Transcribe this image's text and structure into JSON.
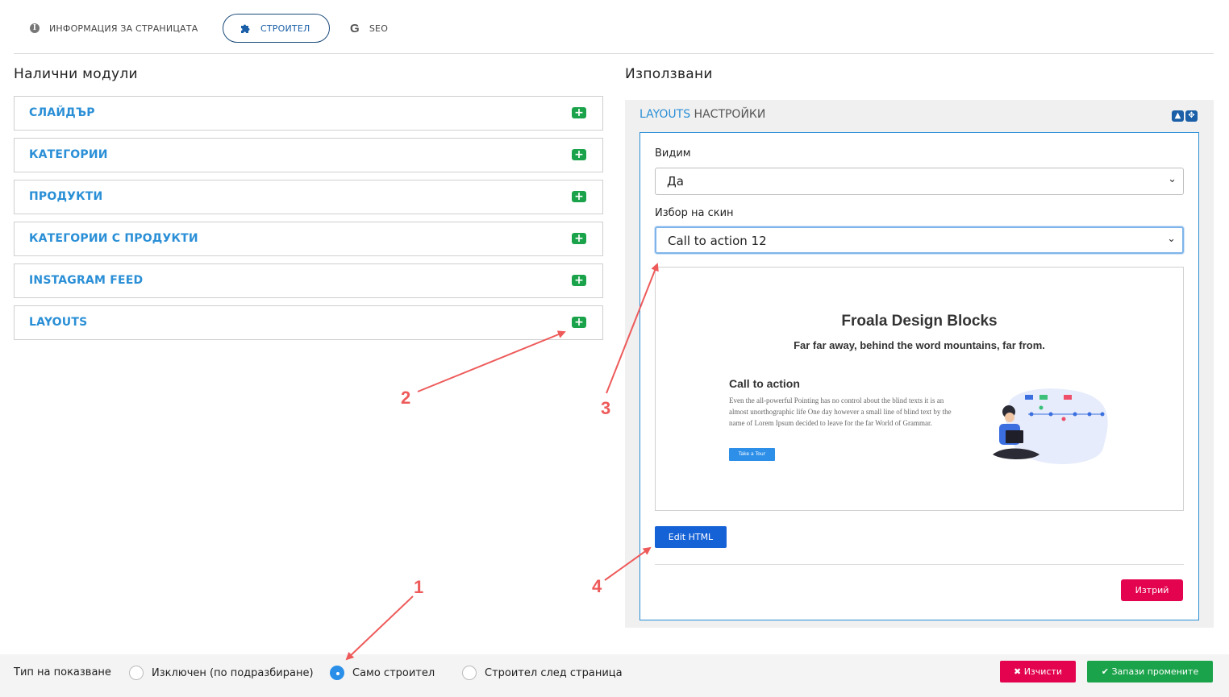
{
  "tabs": [
    {
      "label": "ИНФОРМАЦИЯ ЗА СТРАНИЦАТА",
      "icon": "info-icon"
    },
    {
      "label": "СТРОИТЕЛ",
      "icon": "puzzle-icon",
      "active": true
    },
    {
      "label": "SEO",
      "icon": "google-icon"
    }
  ],
  "left": {
    "title": "Налични модули",
    "modules": [
      {
        "label": "СЛАЙДЪР"
      },
      {
        "label": "КАТЕГОРИИ"
      },
      {
        "label": "ПРОДУКТИ"
      },
      {
        "label": "КАТЕГОРИИ С ПРОДУКТИ"
      },
      {
        "label": "INSTAGRAM FEED"
      },
      {
        "label": "LAYOUTS"
      }
    ],
    "add_icon": "plus-icon"
  },
  "right": {
    "title": "Използвани",
    "panel_title_highlight": "LAYOUTS",
    "panel_title_rest": " НАСТРОЙКИ",
    "visible_label": "Видим",
    "visible_value": "Да",
    "skin_label": "Избор на скин",
    "skin_value": "Call to action 12",
    "edit_html": "Edit HTML",
    "delete": "Изтрий"
  },
  "preview": {
    "title": "Froala Design Blocks",
    "subtitle": "Far far away, behind the word mountains, far from.",
    "cta_title": "Call to action",
    "cta_text": "Even the all-powerful Pointing has no control about the blind texts it is an almost unorthographic life One day however a small line of blind text by the name of Lorem Ipsum decided to leave for the far World of Grammar.",
    "cta_button": "Take a Tour"
  },
  "bottom": {
    "display_label": "Тип на показване",
    "options": [
      {
        "label": "Изключен (по подразбиране)",
        "selected": false
      },
      {
        "label": "Само строител",
        "selected": true
      },
      {
        "label": "Строител след страница",
        "selected": false
      }
    ],
    "clear": "Изчисти",
    "save": "Запази промените"
  },
  "annotations": [
    "1",
    "2",
    "3",
    "4"
  ],
  "colors": {
    "accent": "#2a8fd6",
    "primary_button": "#1561d6",
    "danger": "#e3034e",
    "success": "#1aa34a",
    "annotation": "#ee5a5a"
  }
}
